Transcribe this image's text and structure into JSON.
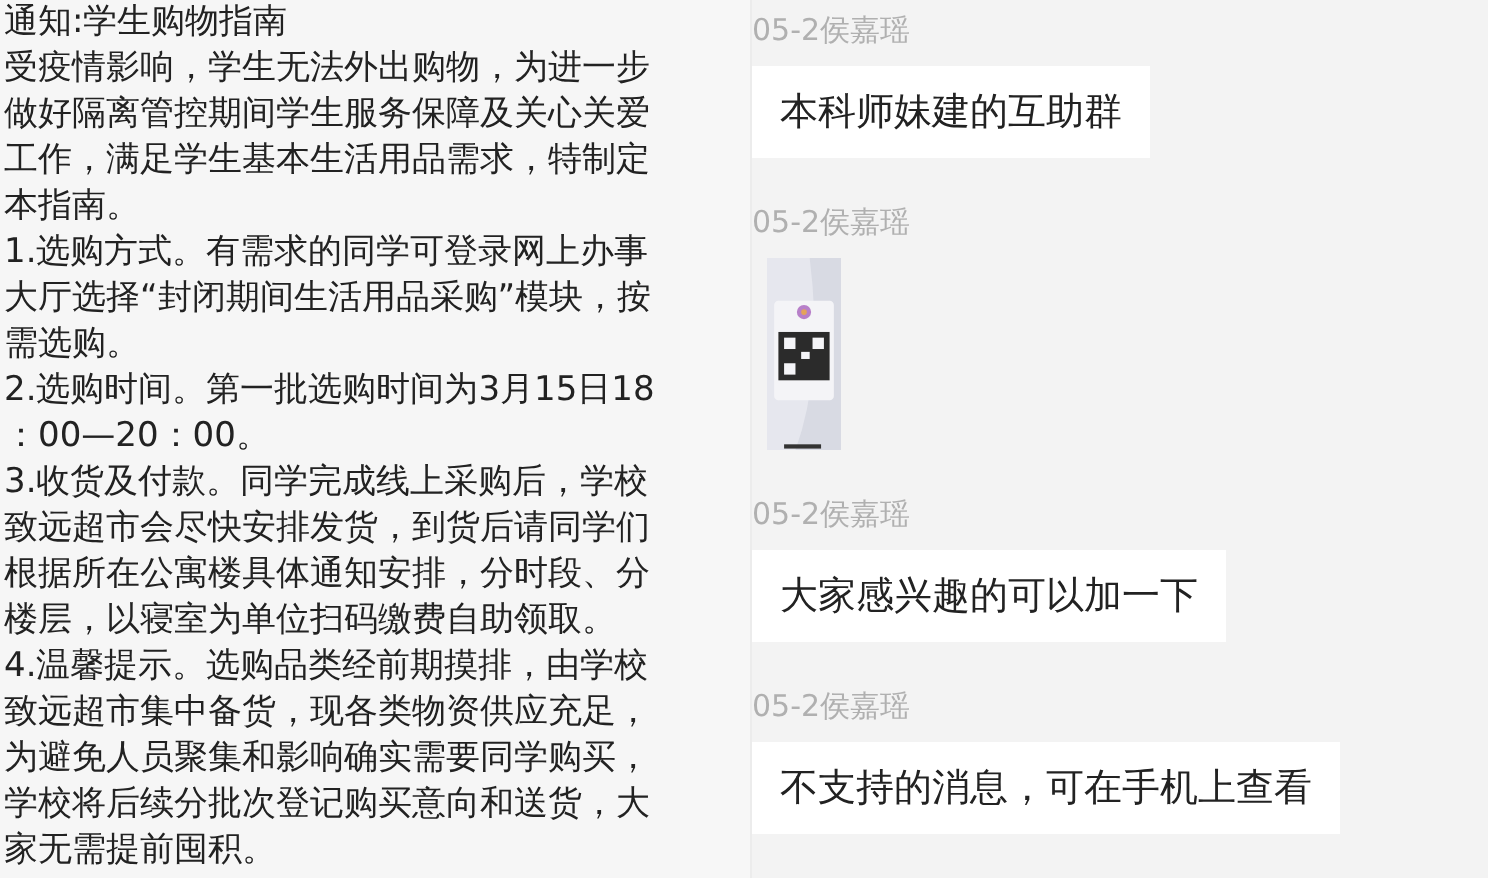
{
  "notice": {
    "title": "通知:学生购物指南",
    "paragraphs": [
      "受疫情影响，学生无法外出购物，为进一步做好隔离管控期间学生服务保障及关心关爱工作，满足学生基本生活用品需求，特制定本指南。",
      "1.选购方式。有需求的同学可登录网上办事大厅选择“封闭期间生活用品采购”模块，按需选购。",
      "2.选购时间。第一批选购时间为3月15日18：00—20：00。",
      "3.收货及付款。同学完成线上采购后，学校致远超市会尽快安排发货，到货后请同学们根据所在公寓楼具体通知安排，分时段、分楼层，以寝室为单位扫码缴费自助领取。",
      "4.温馨提示。选购品类经前期摸排，由学校致远超市集中备货，现各类物资供应充足，为避免人员聚集和影响确实需要同学购买，学校将后续分批次登记购买意向和送货，大家无需提前囤积。"
    ]
  },
  "messages": [
    {
      "sender": "05-2侯嘉瑶",
      "kind": "text",
      "text": "本科师妹建的互助群"
    },
    {
      "sender": "05-2侯嘉瑶",
      "kind": "picture"
    },
    {
      "sender": "05-2侯嘉瑶",
      "kind": "text",
      "text": "大家感兴趣的可以加一下"
    },
    {
      "sender": "05-2侯嘉瑶",
      "kind": "text",
      "text": "不支持的消息，可在手机上查看"
    }
  ]
}
